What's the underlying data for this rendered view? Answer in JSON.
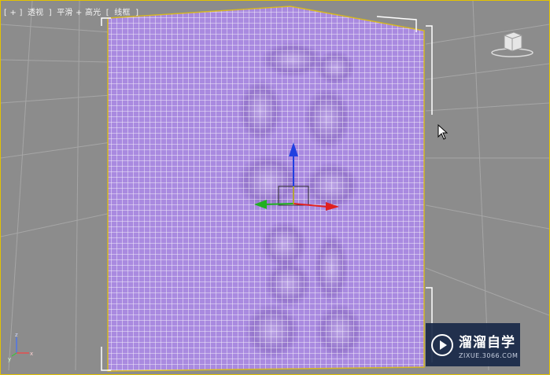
{
  "viewport": {
    "label_parts": [
      "[ + ]",
      "透视",
      "]",
      "平滑 + 高光",
      "[",
      "线框",
      "]"
    ]
  },
  "axis_tripod": {
    "z": "z",
    "x": "x",
    "y": "y"
  },
  "watermark": {
    "title": "溜溜自学",
    "url": "ZIXUE.3066.COM"
  },
  "colors": {
    "viewport_bg": "#8c8c8c",
    "mesh_fill": "#a98ae0",
    "mesh_wire": "#ffffff",
    "selection_bracket": "#ffffff",
    "viewport_border": "#e3c200",
    "gizmo_x": "#e02020",
    "gizmo_y": "#20b020",
    "gizmo_z": "#2040e0"
  },
  "icons": [
    "viewcube-icon",
    "axis-tripod-icon",
    "mouse-cursor-icon",
    "transform-gizmo-icon",
    "watermark-logo-icon"
  ]
}
